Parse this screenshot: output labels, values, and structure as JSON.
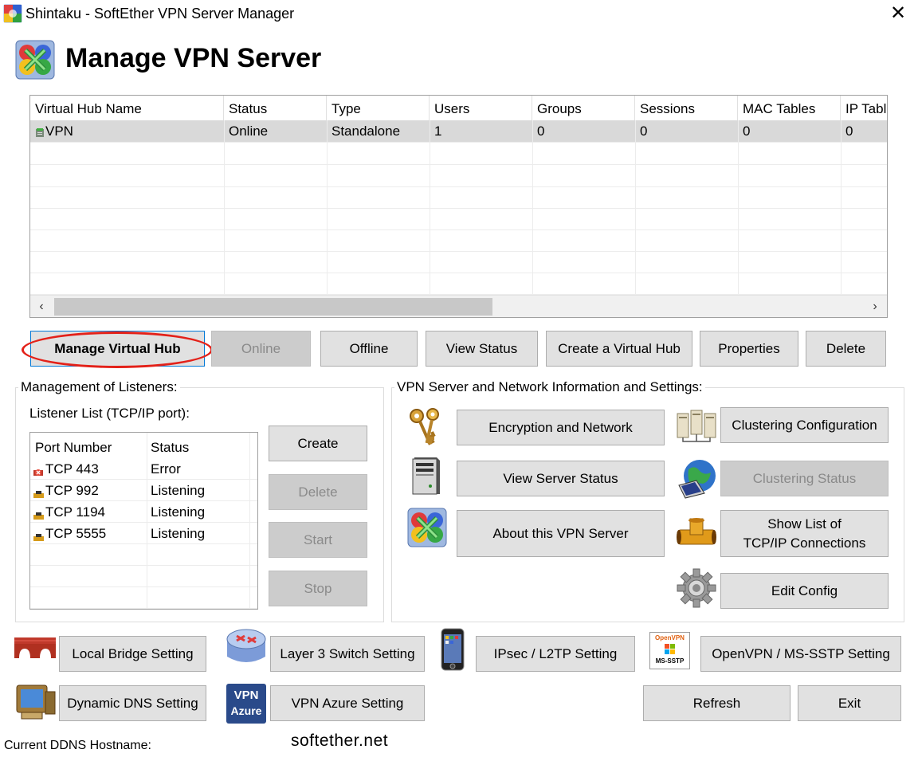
{
  "window": {
    "title": "Shintaku - SoftEther VPN Server Manager",
    "close_glyph": "✕"
  },
  "page_title": "Manage VPN Server",
  "hub_table": {
    "columns": [
      "Virtual Hub Name",
      "Status",
      "Type",
      "Users",
      "Groups",
      "Sessions",
      "MAC Tables",
      "IP Table"
    ],
    "rows": [
      {
        "name": "VPN",
        "status": "Online",
        "type": "Standalone",
        "users": "1",
        "groups": "0",
        "sessions": "0",
        "mac_tables": "0",
        "ip_tables": "0"
      }
    ],
    "scroll_left": "‹",
    "scroll_right": "›"
  },
  "hub_buttons": {
    "manage": "Manage Virtual Hub",
    "online": "Online",
    "offline": "Offline",
    "view_status": "View Status",
    "create": "Create a Virtual Hub",
    "properties": "Properties",
    "delete": "Delete"
  },
  "listeners": {
    "group_title": "Management of Listeners:",
    "list_label": "Listener List (TCP/IP port):",
    "columns": [
      "Port Number",
      "Status"
    ],
    "rows": [
      {
        "port": "TCP 443",
        "status": "Error",
        "state": "error"
      },
      {
        "port": "TCP 992",
        "status": "Listening",
        "state": "ok"
      },
      {
        "port": "TCP 1194",
        "status": "Listening",
        "state": "ok"
      },
      {
        "port": "TCP 5555",
        "status": "Listening",
        "state": "ok"
      }
    ],
    "buttons": {
      "create": "Create",
      "delete": "Delete",
      "start": "Start",
      "stop": "Stop"
    }
  },
  "server_info": {
    "group_title": "VPN Server and Network Information and Settings:",
    "encryption": "Encryption and Network",
    "view_server_status": "View Server Status",
    "about": "About this VPN Server",
    "clustering_config": "Clustering Configuration",
    "clustering_status": "Clustering Status",
    "tcpip_line1": "Show List of",
    "tcpip_line2": "TCP/IP Connections",
    "edit_config": "Edit Config"
  },
  "bottom": {
    "local_bridge": "Local Bridge Setting",
    "layer3": "Layer 3 Switch Setting",
    "ipsec": "IPsec / L2TP Setting",
    "openvpn": "OpenVPN / MS-SSTP Setting",
    "ddns": "Dynamic DNS Setting",
    "azure": "VPN Azure Setting",
    "refresh": "Refresh",
    "exit": "Exit",
    "azure_icon_line1": "VPN",
    "azure_icon_line2": "Azure",
    "openvpn_icon_line1": "OpenVPN",
    "openvpn_icon_line2": "MS-SSTP"
  },
  "ddns_hostname_label": "Current DDNS Hostname:",
  "footer_link": "softether.net",
  "colors": {
    "highlight_oval": "#e32119",
    "selected_row": "#d9d9d9",
    "button_face": "#e1e1e1",
    "disabled_face": "#cccccc",
    "focus_border": "#0078d7"
  }
}
